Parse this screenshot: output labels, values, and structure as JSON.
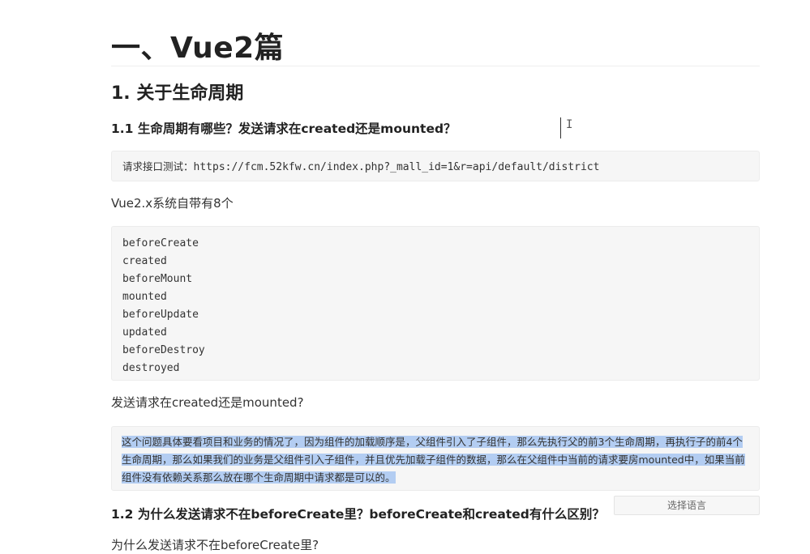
{
  "doc": {
    "title": "一、Vue2篇",
    "section": "1. 关于生命周期",
    "q1_heading": "1.1 生命周期有哪些？发送请求在created还是mounted？",
    "url_label": "请求接口测试：",
    "url": "https://fcm.52kfw.cn/index.php?_mall_id=1&r=api/default/district",
    "hooks_intro": "Vue2.x系统自带有8个",
    "hooks": [
      "beforeCreate",
      "created",
      "beforeMount",
      "mounted",
      "beforeUpdate",
      "updated",
      "beforeDestroy",
      "destroyed"
    ],
    "q_created_or_mounted": "发送请求在created还是mounted?",
    "answer": "这个问题具体要看项目和业务的情况了，因为组件的加载顺序是，父组件引入了子组件，那么先执行父的前3个生命周期，再执行子的前4个生命周期，那么如果我们的业务是父组件引入子组件，并且优先加载子组件的数据，那么在父组件中当前的请求要房mounted中，如果当前组件没有依赖关系那么放在哪个生命周期中请求都是可以的。",
    "lang_button": "选择语言",
    "q2_heading": "1.2 为什么发送请求不在beforeCreate里？beforeCreate和created有什么区别？",
    "q2_sub": "为什么发送请求不在beforeCreate里?"
  }
}
